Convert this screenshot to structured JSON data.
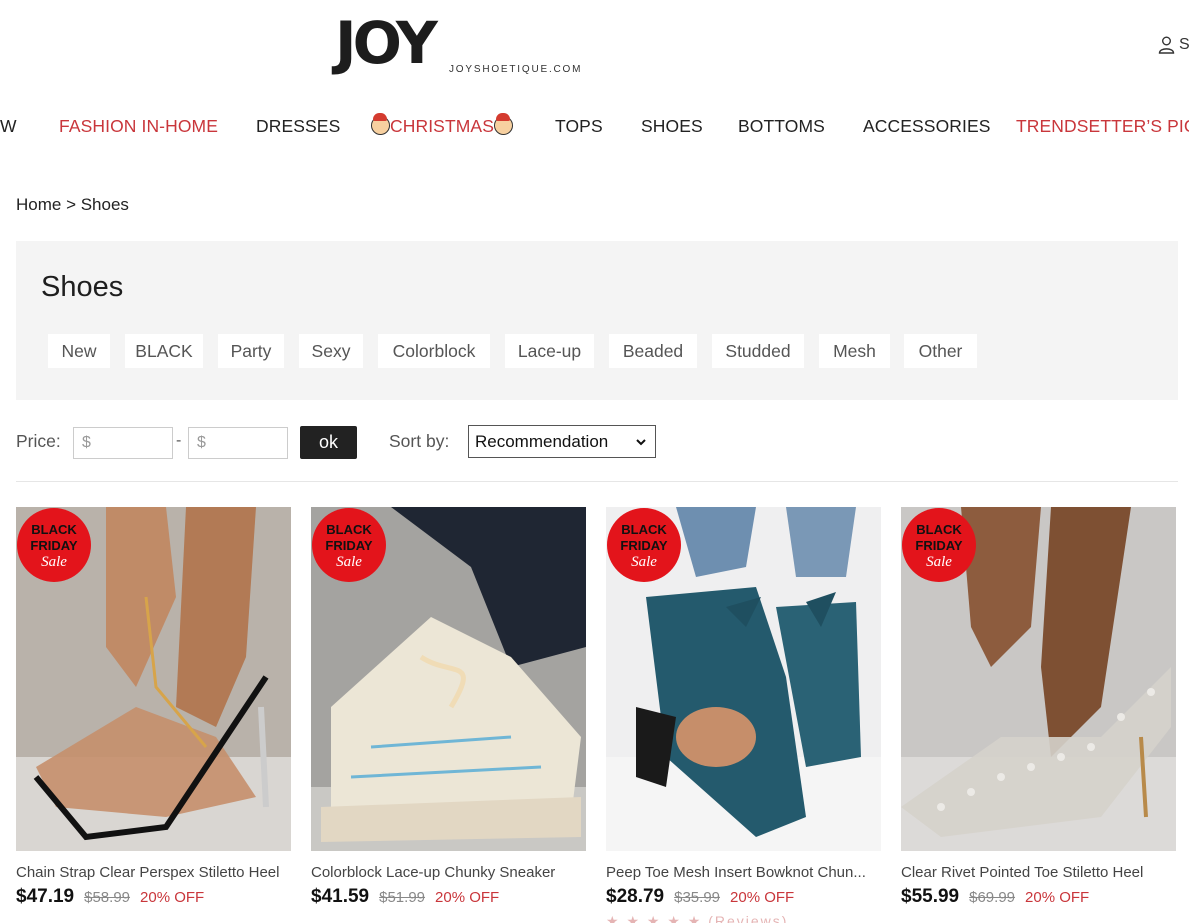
{
  "header": {
    "logo_text": "JOY",
    "logo_subtext": "JOYSHOETIQUE.COM",
    "account_icon": "user-icon",
    "account_text": "S"
  },
  "nav": {
    "items": [
      {
        "label": "W",
        "color": "#222222"
      },
      {
        "label": "FASHION IN-HOME",
        "color": "#c9363b"
      },
      {
        "label": "DRESSES",
        "color": "#222222"
      },
      {
        "label": "CHRISTMAS",
        "color": "#c9363b",
        "icon": "santa-icon"
      },
      {
        "label": "TOPS",
        "color": "#222222"
      },
      {
        "label": "SHOES",
        "color": "#222222"
      },
      {
        "label": "BOTTOMS",
        "color": "#222222"
      },
      {
        "label": "ACCESSORIES",
        "color": "#222222"
      },
      {
        "label": "TRENDSETTER’S PICK",
        "color": "#c9363b"
      }
    ]
  },
  "breadcrumb": "Home > Shoes",
  "category": {
    "title": "Shoes",
    "tags": [
      "New",
      "BLACK",
      "Party",
      "Sexy",
      "Colorblock",
      "Lace-up",
      "Beaded",
      "Studded",
      "Mesh",
      "Other"
    ]
  },
  "filters": {
    "price_label": "Price:",
    "min_placeholder": "$",
    "max_placeholder": "$",
    "dash": "-",
    "ok_label": "ok",
    "sort_label": "Sort by:",
    "sort_value": "Recommendation"
  },
  "badge": {
    "line1": "BLACK",
    "line2": "FRIDAY",
    "line3": "Sale",
    "color": "#e3141b"
  },
  "products": [
    {
      "name": "Chain Strap Clear Perspex Stiletto Heel",
      "price": "$47.19",
      "old_price": "$58.99",
      "discount": "20% OFF"
    },
    {
      "name": "Colorblock Lace-up Chunky Sneaker",
      "price": "$41.59",
      "old_price": "$51.99",
      "discount": "20% OFF"
    },
    {
      "name": "Peep Toe Mesh Insert Bowknot Chun...",
      "price": "$28.79",
      "old_price": "$35.99",
      "discount": "20% OFF",
      "stars": "★ ★ ★ ★ ★ (Reviews)"
    },
    {
      "name": "Clear Rivet Pointed Toe Stiletto Heel",
      "price": "$55.99",
      "old_price": "$69.99",
      "discount": "20% OFF"
    }
  ]
}
